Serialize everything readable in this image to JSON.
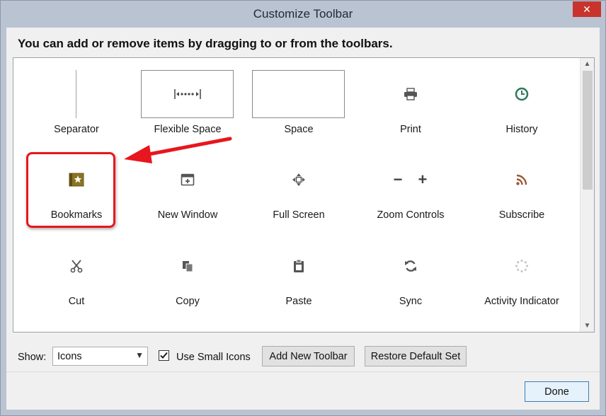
{
  "window": {
    "title": "Customize Toolbar",
    "close_symbol": "✕"
  },
  "instruction": "You can add or remove items by dragging to or from the toolbars.",
  "items": [
    {
      "label": "Separator",
      "icon": "separator-line"
    },
    {
      "label": "Flexible Space",
      "icon": "flexible-space-icon"
    },
    {
      "label": "Space",
      "icon": "space-box"
    },
    {
      "label": "Print",
      "icon": "printer-icon"
    },
    {
      "label": "History",
      "icon": "clock-icon"
    },
    {
      "label": "Bookmarks",
      "icon": "bookmark-star-icon"
    },
    {
      "label": "New Window",
      "icon": "new-window-icon"
    },
    {
      "label": "Full Screen",
      "icon": "fullscreen-icon"
    },
    {
      "label": "Zoom Controls",
      "icon": "zoom-minus-plus-icon",
      "minus": "−",
      "plus": "+"
    },
    {
      "label": "Subscribe",
      "icon": "rss-feed-icon"
    },
    {
      "label": "Cut",
      "icon": "scissors-icon"
    },
    {
      "label": "Copy",
      "icon": "copy-icon"
    },
    {
      "label": "Paste",
      "icon": "clipboard-icon"
    },
    {
      "label": "Sync",
      "icon": "sync-icon"
    },
    {
      "label": "Activity Indicator",
      "icon": "spinner-icon"
    }
  ],
  "footer": {
    "show_label": "Show:",
    "show_value": "Icons",
    "use_small_icons_label": "Use Small Icons",
    "use_small_icons_checked": true,
    "add_toolbar_label": "Add New Toolbar",
    "restore_label": "Restore Default Set",
    "done_label": "Done"
  },
  "colors": {
    "annotation_red": "#e8161e",
    "history_green": "#2f7a5c",
    "rss_brown": "#9a5a36",
    "bookmark_gold": "#8b7421"
  }
}
